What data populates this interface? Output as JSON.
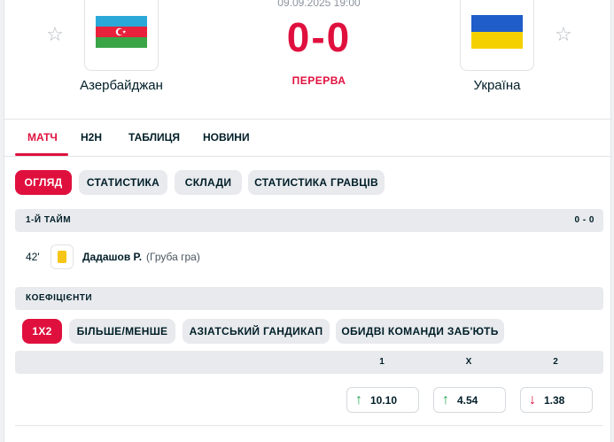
{
  "match": {
    "datetime": "09.09.2025 19:00",
    "score": "0-0",
    "status": "ПЕРЕРВА",
    "home": {
      "name": "Азербайджан",
      "flag": "azerbaijan-flag-icon"
    },
    "away": {
      "name": "Україна",
      "flag": "ukraine-flag-icon"
    }
  },
  "main_tabs": [
    {
      "label": "МАТЧ",
      "active": true
    },
    {
      "label": "H2H",
      "active": false
    },
    {
      "label": "ТАБЛИЦЯ",
      "active": false
    },
    {
      "label": "НОВИНИ",
      "active": false
    }
  ],
  "sub_tabs": [
    {
      "label": "ОГЛЯД",
      "active": true
    },
    {
      "label": "СТАТИСТИКА",
      "active": false
    },
    {
      "label": "СКЛАДИ",
      "active": false
    },
    {
      "label": "СТАТИСТИКА ГРАВЦІВ",
      "active": false
    }
  ],
  "first_half": {
    "title": "1-Й ТАЙМ",
    "score": "0 - 0",
    "incidents": [
      {
        "minute": "42'",
        "type": "yellow-card-icon",
        "player": "Дадашов Р.",
        "reason": "(Груба гра)"
      }
    ]
  },
  "odds": {
    "title": "КОЕФІЦІЄНТИ",
    "tabs": [
      {
        "label": "1X2",
        "active": true
      },
      {
        "label": "БІЛЬШЕ/МЕНШЕ",
        "active": false
      },
      {
        "label": "АЗІАТСЬКИЙ ГАНДИКАП",
        "active": false
      },
      {
        "label": "ОБИДВІ КОМАНДИ ЗАБ'ЮТЬ",
        "active": false
      }
    ],
    "columns": [
      "1",
      "X",
      "2"
    ],
    "values": [
      {
        "value": "10.10",
        "trend": "up"
      },
      {
        "value": "4.54",
        "trend": "up"
      },
      {
        "value": "1.38",
        "trend": "down"
      }
    ]
  },
  "colors": {
    "accent": "#e0103e",
    "up": "#1fa84f",
    "down": "#e0103e",
    "pill_bg": "#e8eaed"
  }
}
